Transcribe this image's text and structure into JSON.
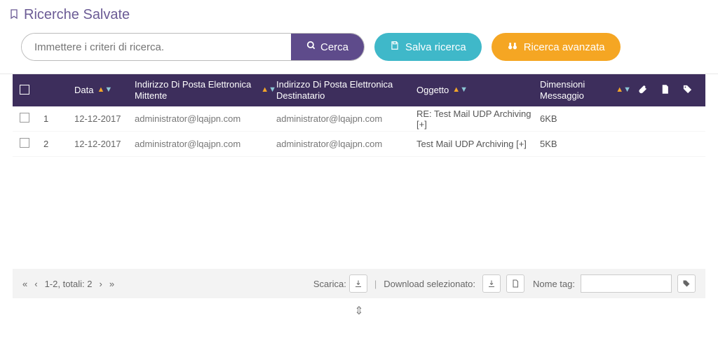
{
  "header": {
    "title": "Ricerche Salvate"
  },
  "search": {
    "placeholder": "Immettere i criteri di ricerca.",
    "search_label": "Cerca",
    "save_label": "Salva ricerca",
    "advanced_label": "Ricerca avanzata"
  },
  "columns": {
    "date": "Data",
    "from": "Indirizzo Di Posta Elettronica Mittente",
    "to": "Indirizzo Di Posta Elettronica Destinatario",
    "subject": "Oggetto",
    "size": "Dimensioni Messaggio"
  },
  "rows": [
    {
      "n": "1",
      "date": "12-12-2017",
      "from": "administrator@lqajpn.com",
      "to": "administrator@lqajpn.com",
      "subject": "RE: Test Mail UDP Archiving [+]",
      "size": "6KB"
    },
    {
      "n": "2",
      "date": "12-12-2017",
      "from": "administrator@lqajpn.com",
      "to": "administrator@lqajpn.com",
      "subject": "Test Mail UDP Archiving [+]",
      "size": "5KB"
    }
  ],
  "footer": {
    "pager_text": "1-2, totali: 2",
    "download_label": "Scarica:",
    "download_selected_label": "Download selezionato:",
    "tag_label": "Nome tag:"
  }
}
